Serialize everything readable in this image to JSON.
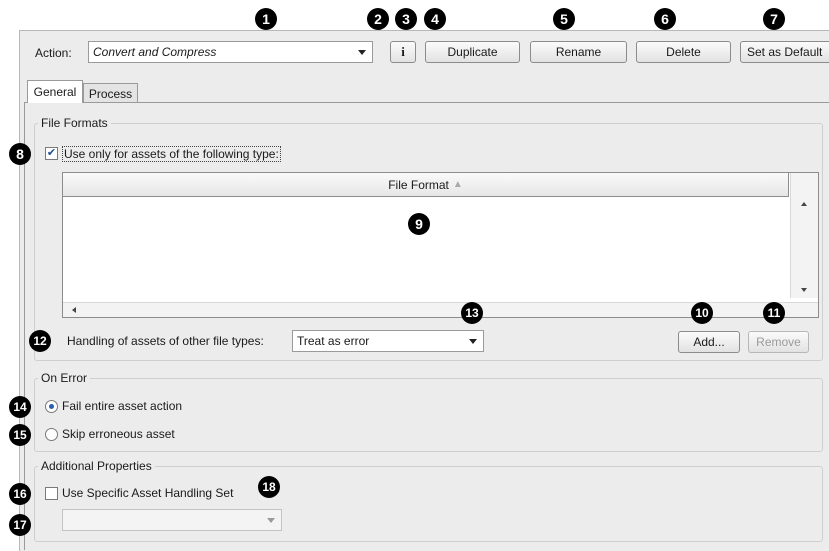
{
  "toolbar": {
    "action_label": "Action:",
    "action_value": "Convert and Compress",
    "info_glyph": "i",
    "duplicate_label": "Duplicate",
    "rename_label": "Rename",
    "delete_label": "Delete",
    "set_default_label": "Set as Default"
  },
  "tabs": [
    {
      "label": "General",
      "selected": true
    },
    {
      "label": "Process",
      "selected": false
    }
  ],
  "file_formats": {
    "group_title": "File Formats",
    "use_only_label": "Use only for assets of the following type:",
    "use_only_checked": true,
    "column_header": "File Format",
    "sort_glyph": "▲",
    "rows": [],
    "handling_label": "Handling of assets of other file types:",
    "handling_value": "Treat as error",
    "add_label": "Add...",
    "remove_label": "Remove"
  },
  "on_error": {
    "group_title": "On Error",
    "options": [
      {
        "label": "Fail entire asset action",
        "selected": true
      },
      {
        "label": "Skip erroneous asset",
        "selected": false
      }
    ]
  },
  "additional": {
    "group_title": "Additional Properties",
    "use_specific_label": "Use Specific Asset Handling Set",
    "use_specific_checked": false,
    "handling_set_value": ""
  },
  "callouts": [
    "1",
    "2",
    "3",
    "4",
    "5",
    "6",
    "7",
    "8",
    "9",
    "10",
    "11",
    "12",
    "13",
    "14",
    "15",
    "16",
    "17",
    "18"
  ],
  "colors": {
    "panel_bg": "#ececec",
    "callout_bg": "#000000",
    "callout_fg": "#ffffff",
    "radio_dot": "#2b5fb3"
  }
}
